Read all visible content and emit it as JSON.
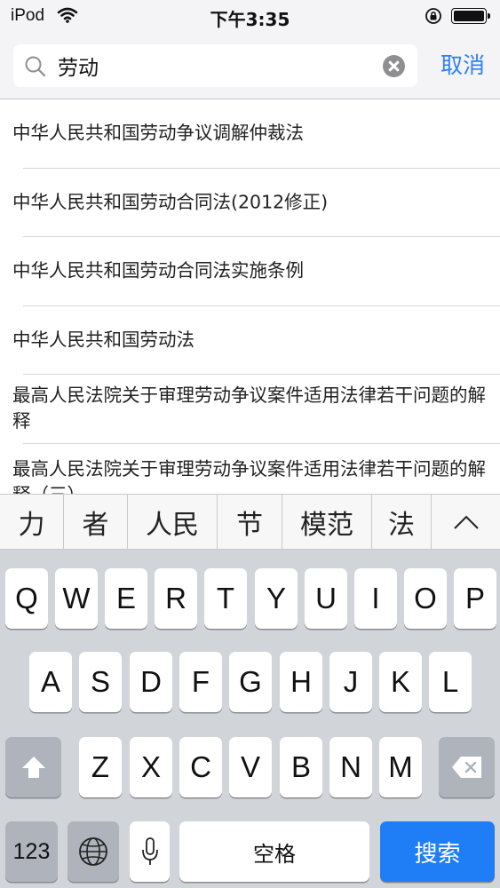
{
  "status_bar": {
    "carrier": "iPod",
    "time": "下午3:35"
  },
  "search": {
    "query": "劳动",
    "cancel_label": "取消"
  },
  "results": [
    "中华人民共和国劳动争议调解仲裁法",
    "中华人民共和国劳动合同法(2012修正)",
    "中华人民共和国劳动合同法实施条例",
    "中华人民共和国劳动法",
    "最高人民法院关于审理劳动争议案件适用法律若干问题的解释",
    "最高人民法院关于审理劳动争议案件适用法律若干问题的解释（三）"
  ],
  "candidates": [
    "力",
    "者",
    "人民",
    "节",
    "模范",
    "法"
  ],
  "keyboard": {
    "row1": [
      "Q",
      "W",
      "E",
      "R",
      "T",
      "Y",
      "U",
      "I",
      "O",
      "P"
    ],
    "row2": [
      "A",
      "S",
      "D",
      "F",
      "G",
      "H",
      "J",
      "K",
      "L"
    ],
    "row3": [
      "Z",
      "X",
      "C",
      "V",
      "B",
      "N",
      "M"
    ],
    "numbers_label": "123",
    "space_label": "空格",
    "search_label": "搜索"
  },
  "icons": {
    "wifi": "wifi-icon",
    "lock": "rotation-lock-icon",
    "battery": "battery-icon",
    "search": "search-icon",
    "clear": "clear-icon",
    "collapse": "chevron-up-icon",
    "shift": "shift-icon",
    "delete": "delete-icon",
    "globe": "globe-icon",
    "mic": "microphone-icon"
  },
  "colors": {
    "accent": "#2f7ff6",
    "search_key": "#1f7ef6",
    "keyboard_bg": "#d1d4d9",
    "fn_key": "#aeb3bc"
  }
}
